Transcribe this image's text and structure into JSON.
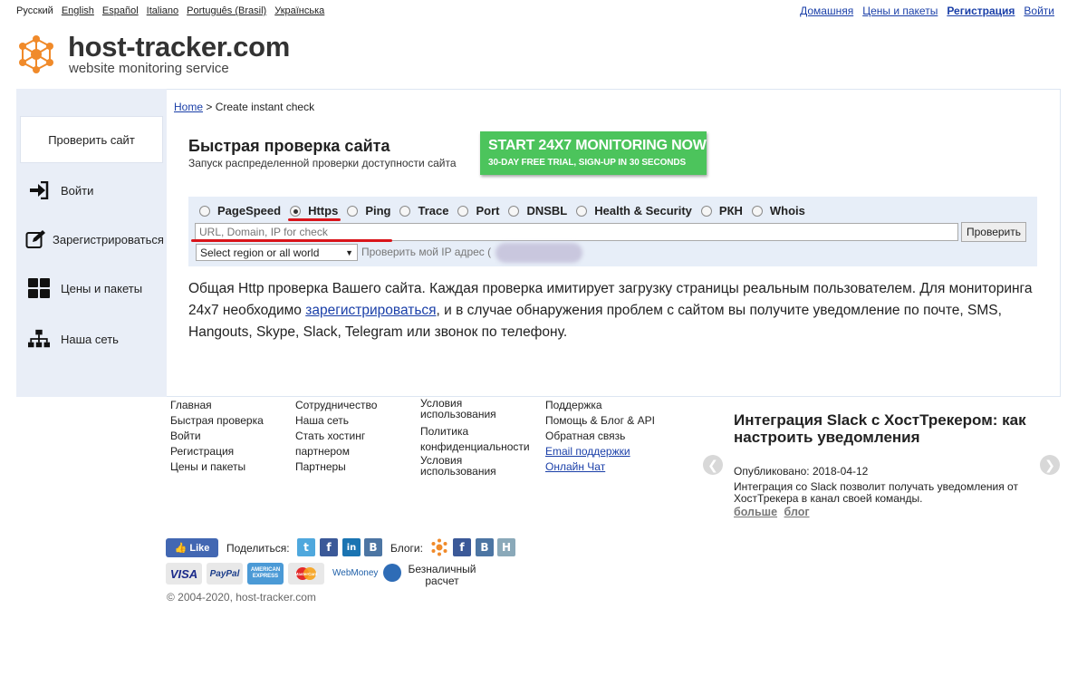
{
  "languages": [
    "Русский",
    "English",
    "Español",
    "Italiano",
    "Português (Brasil)",
    "Українська"
  ],
  "topnav": {
    "home": "Домашняя",
    "pricing": "Цены и пакеты",
    "register": "Регистрация",
    "login": "Войти"
  },
  "logo": {
    "title": "host-tracker.com",
    "subtitle": "website monitoring service"
  },
  "sidebar": {
    "items": [
      {
        "label": "Проверить сайт",
        "icon": "none"
      },
      {
        "label": "Войти",
        "icon": "login-icon"
      },
      {
        "label": "Зарегистрироваться",
        "icon": "edit-icon"
      },
      {
        "label": "Цены и пакеты",
        "icon": "grid-icon"
      },
      {
        "label": "Наша сеть",
        "icon": "network-icon"
      }
    ]
  },
  "breadcrumb": {
    "home": "Home",
    "separator": ">",
    "current": "Create instant check"
  },
  "heading": {
    "title": "Быстрая проверка сайта",
    "subtitle": "Запуск распределенной проверки доступности сайта"
  },
  "cta": {
    "line1": "START 24X7 MONITORING NOW",
    "line2": "30-DAY FREE TRIAL, SIGN-UP IN 30 SECONDS",
    "color": "#4cc45c"
  },
  "check_types": [
    {
      "label": "PageSpeed",
      "checked": false
    },
    {
      "label": "Https",
      "checked": true
    },
    {
      "label": "Ping",
      "checked": false
    },
    {
      "label": "Trace",
      "checked": false
    },
    {
      "label": "Port",
      "checked": false
    },
    {
      "label": "DNSBL",
      "checked": false
    },
    {
      "label": "Health & Security",
      "checked": false
    },
    {
      "label": "РКН",
      "checked": false
    },
    {
      "label": "Whois",
      "checked": false
    }
  ],
  "form": {
    "url_placeholder": "URL, Domain, IP for check",
    "url_value": "",
    "check_button": "Проверить",
    "region_selected": "Select region or all world",
    "my_ip": "Проверить мой IP адрес ("
  },
  "description": {
    "part1": "Общая Http проверка Вашего сайта. Каждая проверка имитирует загрузку страницы реальным пользователем. Для мониторинга 24х7 необходимо ",
    "link": "зарегистрироваться",
    "part2": ", и в случае обнаружения проблем с сайтом вы получите уведомление по почте, SMS, Hangouts, Skype, Slack, Telegram или звонок по телефону."
  },
  "footer": {
    "col1": [
      "Главная",
      "Быстрая проверка",
      "Войти",
      "Регистрация",
      "Цены и пакеты"
    ],
    "col2": [
      "Сотрудничество",
      "Наша сеть",
      "Стать хостинг партнером",
      "Партнеры"
    ],
    "col3": [
      "Условия использования",
      "Политика конфиденциальности",
      "Условия использования"
    ],
    "col4_text": [
      "Поддержка",
      "Помощь & Блог & API",
      "Обратная связь"
    ],
    "col4_links": [
      "Email поддержки",
      "Онлайн Чат"
    ]
  },
  "news": {
    "title": "Интеграция Slack с ХостТрекером: как настроить уведомления",
    "date": "Опубликовано: 2018-04-12",
    "text": "Интеграция со Slack позволит получать уведомления от ХостТрекера в канал своей команды.",
    "more": "больше",
    "blog": "блог"
  },
  "social": {
    "like": "Like",
    "share_label": "Поделиться:",
    "blogs_label": "Блоги:"
  },
  "payments": {
    "visa": "VISA",
    "paypal": "PayPal",
    "amex": "AMERICAN EXPRESS",
    "mastercard": "MasterCard",
    "webmoney": "WebMoney",
    "cashless": "Безналичный расчет"
  },
  "copyright": "© 2004-2020, host-tracker.com"
}
